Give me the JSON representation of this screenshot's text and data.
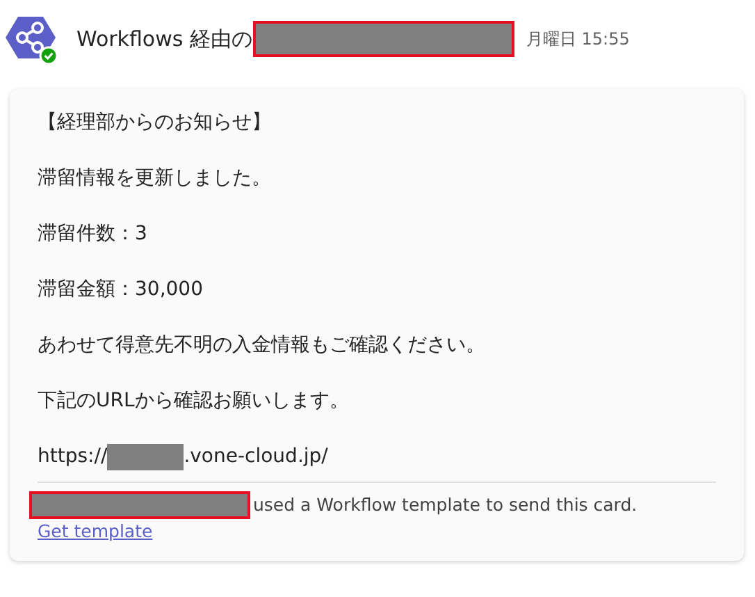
{
  "header": {
    "sender_prefix": "Workflows 経由の",
    "time": "月曜日 15:55"
  },
  "card": {
    "lines": [
      "【経理部からのお知らせ】",
      "滞留情報を更新しました。",
      "滞留件数：3",
      "滞留金額：30,000",
      "あわせて得意先不明の入金情報もご確認ください。",
      "下記のURLから確認お願いします。"
    ],
    "url_prefix": "https://",
    "url_suffix": ".vone-cloud.jp/",
    "footer_text": "used a Workflow template to send this card.",
    "footer_link": "Get template"
  }
}
